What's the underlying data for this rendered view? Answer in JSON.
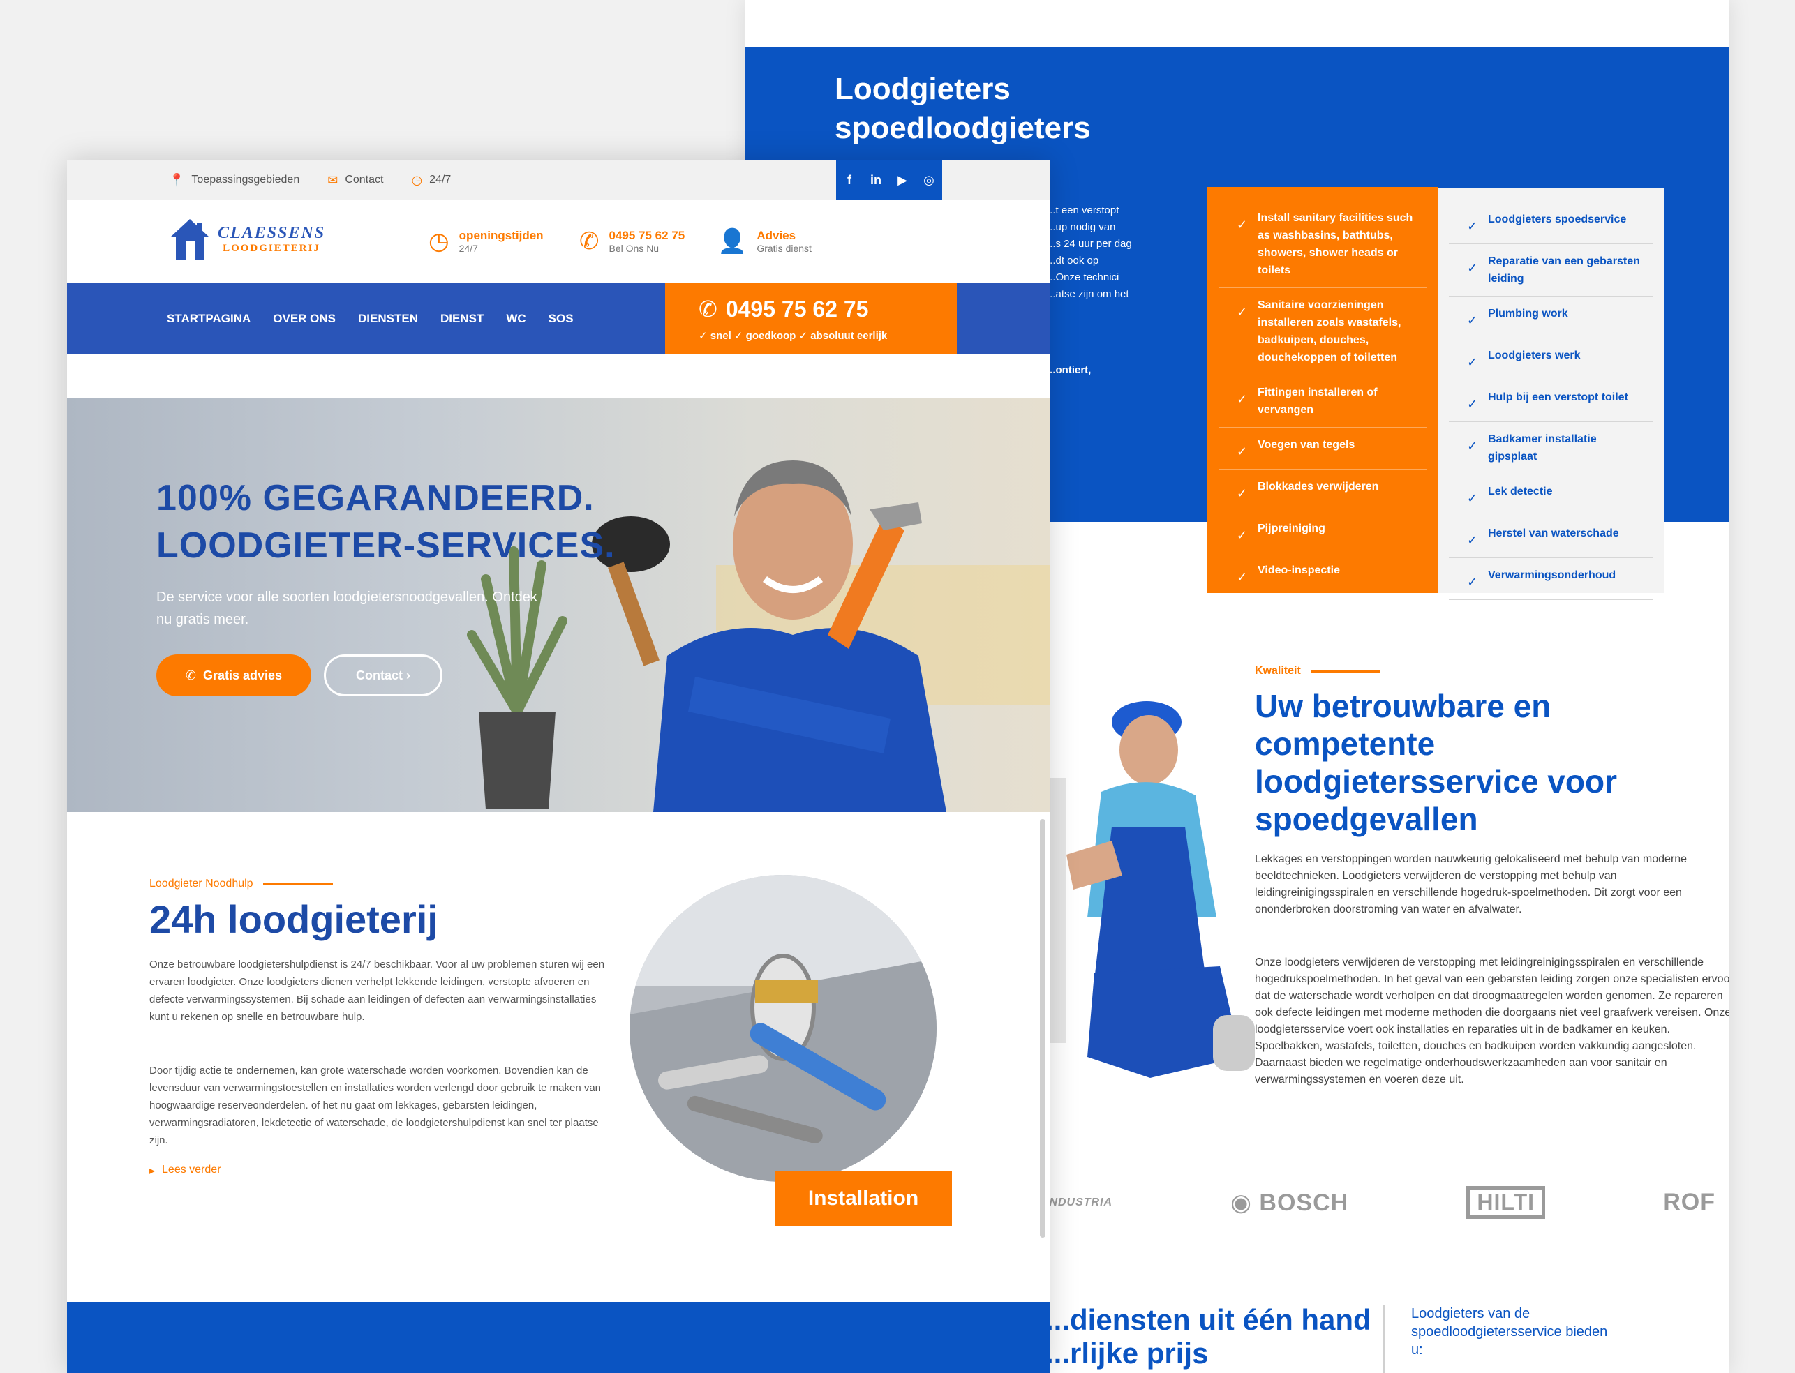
{
  "back": {
    "blue_title": "Loodgieters\nspoedloodgieters\n...n",
    "blue_text": "...t een verstopt\n...up nodig van\n...s 24 uur per dag\n...dt ook op\n...Onze technici\n...atse zijn om het",
    "blue_text2": "...ontiert,",
    "services_orange": [
      "Install sanitary facilities such as washbasins, bathtubs, showers, shower heads or toilets",
      "Sanitaire voorzieningen installeren zoals wastafels, badkuipen, douches, douchekoppen of toiletten",
      "Fittingen installeren of vervangen",
      "Voegen van tegels",
      "Blokkades verwijderen",
      "Pijpreiniging",
      "Video-inspectie"
    ],
    "services_grey": [
      "Loodgieters spoedservice",
      "Reparatie van een gebarsten leiding",
      "Plumbing work",
      "Loodgieters werk",
      "Hulp bij een verstopt toilet",
      "Badkamer installatie gipsplaat",
      "Lek detectie",
      "Herstel van waterschade",
      "Verwarmingsonderhoud"
    ],
    "quality_label": "Kwaliteit",
    "quality_title": "Uw betrouwbare en competente loodgietersservice voor spoedgevallen",
    "quality_p1": "Lekkages en verstoppingen worden nauwkeurig gelokaliseerd met behulp van moderne beeldtechnieken. Loodgieters verwijderen de verstopping met behulp van leidingreinigingsspiralen en verschillende hogedruk-spoelmethoden. Dit zorgt voor een ononderbroken doorstroming van water en afvalwater.",
    "quality_p2": "Onze loodgieters verwijderen de verstopping met leidingreinigingsspiralen en verschillende hogedrukspoelmethoden. In het geval van een gebarsten leiding zorgen onze specialisten ervoor dat de waterschade wordt verholpen en dat droogmaatregelen worden genomen. Ze repareren ook defecte leidingen met moderne methoden die doorgaans niet veel graafwerk vereisen. Onze loodgietersservice voert ook installaties en reparaties uit in de badkamer en keuken. Spoelbakken, wastafels, toiletten, douches en badkuipen worden vakkundig aangesloten. Daarnaast bieden we regelmatige onderhoudswerkzaamheden aan voor sanitair en verwarmingssystemen en voeren deze uit.",
    "brands": [
      "INDUSTRIA",
      "BOSCH",
      "HILTI",
      "ROF"
    ],
    "bottom_title": "...diensten uit één hand\n...rlijke prijs",
    "bottom_side": "Loodgieters van de spoedloodgietersservice bieden u:"
  },
  "front": {
    "topbar": {
      "item1": "Toepassingsgebieden",
      "item2": "Contact",
      "item3": "24/7"
    },
    "logo": {
      "name": "CLAESSENS",
      "sub": "LOODGIETERIJ"
    },
    "header_info": [
      {
        "title": "openingstijden",
        "sub": "24/7"
      },
      {
        "title": "0495 75 62 75",
        "sub": "Bel Ons Nu"
      },
      {
        "title": "Advies",
        "sub": "Gratis dienst"
      }
    ],
    "nav": [
      "STARTPAGINA",
      "OVER ONS",
      "DIENSTEN",
      "DIENST",
      "WC",
      "SOS"
    ],
    "phone": {
      "number": "0495 75 62 75",
      "sub": "✓ snel ✓ goedkoop ✓ absoluut eerlijk"
    },
    "hero": {
      "title_line1": "100% GEGARANDEERD.",
      "title_line2": "LOODGIETER-SERVICES.",
      "sub": "De service voor alle soorten loodgietersnoodgevallen. Ontdek nu gratis meer.",
      "btn_advice": "Gratis advies",
      "btn_contact": "Contact ›"
    },
    "section": {
      "label": "Loodgieter Noodhulp",
      "title": "24h loodgieterij",
      "p1": "Onze betrouwbare loodgietershulpdienst is 24/7 beschikbaar. Voor al uw problemen sturen wij een ervaren loodgieter. Onze loodgieters dienen verhelpt lekkende leidingen, verstopte afvoeren en defecte verwarmingssystemen. Bij schade aan leidingen of defecten aan verwarmingsinstallaties kunt u rekenen op snelle en betrouwbare hulp.",
      "p2": "Door tijdig actie te ondernemen, kan grote waterschade worden voorkomen. Bovendien kan de levensduur van verwarmingstoestellen en installaties worden verlengd door gebruik te maken van hoogwaardige reserveonderdelen. of het nu gaat om lekkages, gebarsten leidingen, verwarmingsradiatoren, lekdetectie of waterschade, de loodgietershulpdienst kan snel ter plaatse zijn.",
      "read_more": "Lees verder",
      "install_label": "Installation"
    }
  },
  "colors": {
    "blue": "#0a54c2",
    "nav_blue": "#2a55b8",
    "orange": "#fd7a00"
  }
}
